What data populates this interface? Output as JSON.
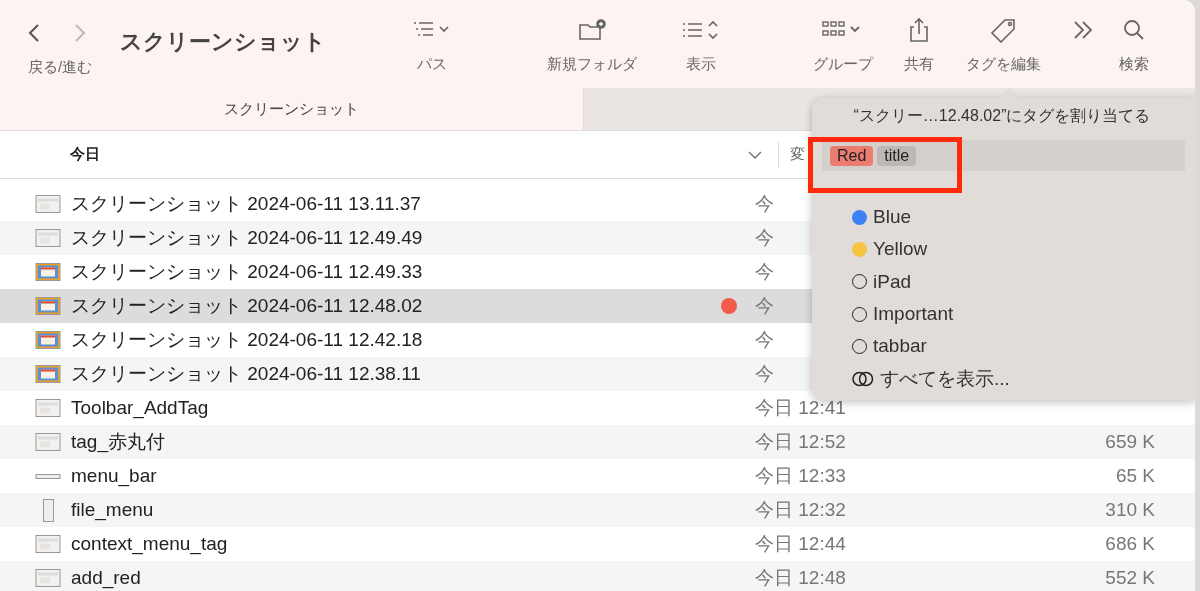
{
  "toolbar": {
    "nav_label": "戻る/進む",
    "back_enabled": true,
    "forward_enabled": false,
    "title": "スクリーンショット",
    "items": [
      {
        "kind": "path",
        "label": "パス"
      },
      {
        "kind": "new-folder",
        "label": "新規フォルダ"
      },
      {
        "kind": "view",
        "label": "表示"
      },
      {
        "kind": "group",
        "label": "グループ"
      },
      {
        "kind": "share",
        "label": "共有"
      },
      {
        "kind": "tag",
        "label": "タグを編集"
      },
      {
        "kind": "more"
      },
      {
        "kind": "search",
        "label": "検索"
      }
    ]
  },
  "tabs": [
    {
      "label": "スクリーンショット",
      "selected": true
    },
    {
      "selected": false
    }
  ],
  "list": {
    "group_header": "今日",
    "column_2_header": "変",
    "rows": [
      {
        "name": "スクリーンショット 2024-06-11 13.11.37",
        "kind": "screenshot",
        "date": "今",
        "selected": false
      },
      {
        "name": "スクリーンショット 2024-06-11 12.49.49",
        "kind": "screenshot",
        "date": "今",
        "selected": false
      },
      {
        "name": "スクリーンショット 2024-06-11 12.49.33",
        "kind": "screenshot-color",
        "date": "今",
        "selected": false
      },
      {
        "name": "スクリーンショット 2024-06-11 12.48.02",
        "kind": "screenshot-color",
        "date": "今",
        "selected": true,
        "color": "#f25c4f"
      },
      {
        "name": "スクリーンショット 2024-06-11 12.42.18",
        "kind": "screenshot-color",
        "date": "今",
        "selected": false
      },
      {
        "name": "スクリーンショット 2024-06-11 12.38.11",
        "kind": "screenshot-color",
        "date": "今",
        "selected": false
      },
      {
        "name": "Toolbar_AddTag",
        "kind": "screenshot",
        "date": "今日 12:41",
        "selected": false
      },
      {
        "name": "tag_赤丸付",
        "kind": "screenshot",
        "date": "今日 12:52",
        "size": "659 K",
        "selected": false
      },
      {
        "name": "menu_bar",
        "kind": "wide",
        "date": "今日 12:33",
        "size": "65 K",
        "selected": false
      },
      {
        "name": "file_menu",
        "kind": "tall",
        "date": "今日 12:32",
        "size": "310 K",
        "selected": false
      },
      {
        "name": "context_menu_tag",
        "kind": "screenshot",
        "date": "今日 12:44",
        "size": "686 K",
        "selected": false
      },
      {
        "name": "add_red",
        "kind": "screenshot",
        "date": "今日 12:48",
        "size": "552 K",
        "selected": false
      }
    ]
  },
  "tag_popover": {
    "title": "“スクリー…12.48.02”にタグを割り当てる",
    "assigned": [
      {
        "label": "Red",
        "color": "#ec7b70"
      },
      {
        "label": "title",
        "color": "#bdb8b6"
      }
    ],
    "highlighted": true,
    "tags": [
      {
        "kind": "colored",
        "label": "Blue",
        "color": "#3b82f6"
      },
      {
        "kind": "colored",
        "label": "Yellow",
        "color": "#f6c343"
      },
      {
        "kind": "plain",
        "label": "iPad"
      },
      {
        "kind": "plain",
        "label": "Important"
      },
      {
        "kind": "plain",
        "label": "tabbar"
      },
      {
        "kind": "show-all",
        "label": "すべてを表示..."
      }
    ]
  }
}
